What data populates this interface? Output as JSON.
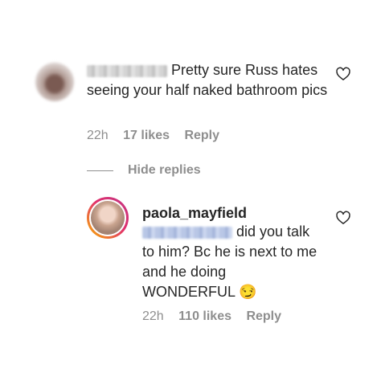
{
  "comment1": {
    "text": "Pretty sure Russ hates seeing your half naked bathroom pics",
    "time": "22h",
    "likes": "17 likes",
    "reply": "Reply"
  },
  "hide_replies": "Hide replies",
  "comment2": {
    "username": "paola_mayfield",
    "text_line1": "did you talk",
    "text_line2": "to him? Bc he is next to me",
    "text_line3": "and he doing",
    "text_line4": "WONDERFUL",
    "emoji": "😏",
    "time": "22h",
    "likes": "110 likes",
    "reply": "Reply"
  },
  "icons": [
    "heart-icon",
    "smirk-emoji"
  ]
}
